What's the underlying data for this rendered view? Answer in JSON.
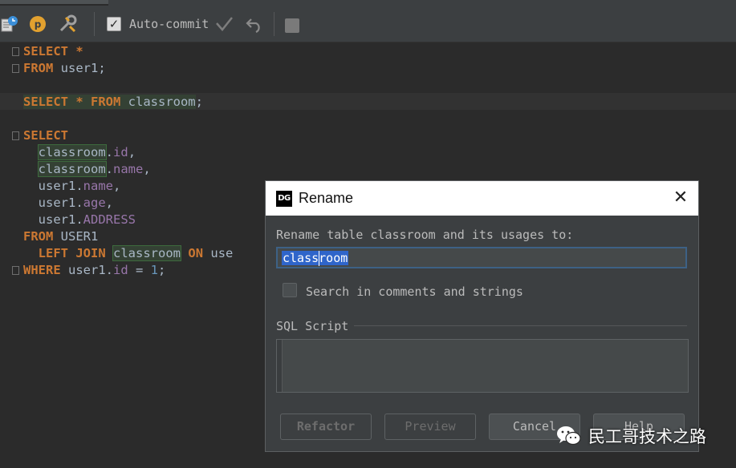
{
  "toolbar": {
    "autocommit_label": "Auto-commit",
    "autocommit_checked": true,
    "icons": [
      "execute-plan-icon",
      "parameters-icon",
      "settings-icon",
      "commit-icon",
      "rollback-icon",
      "stop-icon"
    ]
  },
  "editor": {
    "lines": [
      {
        "parts": [
          [
            "kw",
            "SELECT"
          ],
          [
            "txt",
            " "
          ],
          [
            "kw",
            "*"
          ]
        ]
      },
      {
        "parts": [
          [
            "kw",
            "FROM"
          ],
          [
            "txt",
            " user1;"
          ]
        ]
      },
      {
        "parts": []
      },
      {
        "parts": [
          [
            "kwhl",
            "SELECT * FROM "
          ],
          [
            "txthl",
            "classroom"
          ],
          [
            "txt",
            ";"
          ]
        ]
      },
      {
        "parts": []
      },
      {
        "parts": [
          [
            "kw",
            "SELECT"
          ]
        ]
      },
      {
        "parts": [
          [
            "txt",
            "  "
          ],
          [
            "txthl",
            "classroom"
          ],
          [
            "txt",
            "."
          ],
          [
            "fld",
            "id"
          ],
          [
            "txt",
            ","
          ]
        ]
      },
      {
        "parts": [
          [
            "txt",
            "  "
          ],
          [
            "txthl",
            "classroom"
          ],
          [
            "txt",
            "."
          ],
          [
            "fld",
            "name"
          ],
          [
            "txt",
            ","
          ]
        ]
      },
      {
        "parts": [
          [
            "txt",
            "  user1."
          ],
          [
            "fld",
            "name"
          ],
          [
            "txt",
            ","
          ]
        ]
      },
      {
        "parts": [
          [
            "txt",
            "  user1."
          ],
          [
            "fld",
            "age"
          ],
          [
            "txt",
            ","
          ]
        ]
      },
      {
        "parts": [
          [
            "txt",
            "  user1."
          ],
          [
            "fld",
            "ADDRESS"
          ]
        ]
      },
      {
        "parts": [
          [
            "kw",
            "FROM"
          ],
          [
            "txt",
            " USER1"
          ]
        ]
      },
      {
        "parts": [
          [
            "txt",
            "  "
          ],
          [
            "kw",
            "LEFT JOIN"
          ],
          [
            "txt",
            " "
          ],
          [
            "txthl",
            "classroom"
          ],
          [
            "txt",
            " "
          ],
          [
            "kw",
            "ON"
          ],
          [
            "txt",
            " use"
          ]
        ]
      },
      {
        "parts": [
          [
            "kw",
            "WHERE"
          ],
          [
            "txt",
            " user1."
          ],
          [
            "fld",
            "id"
          ],
          [
            "txt",
            " = "
          ],
          [
            "num",
            "1"
          ],
          [
            "txt",
            ";"
          ]
        ]
      }
    ]
  },
  "dialog": {
    "title": "Rename",
    "prompt": "Rename table classroom and its usages to:",
    "input_value": "classroom",
    "search_label": "Search in comments and strings",
    "search_checked": false,
    "sql_section_label": "SQL Script",
    "buttons": {
      "refactor": "Refactor",
      "preview": "Preview",
      "cancel": "Cancel",
      "help": "Help"
    }
  },
  "watermark": {
    "text": "民工哥技术之路"
  }
}
